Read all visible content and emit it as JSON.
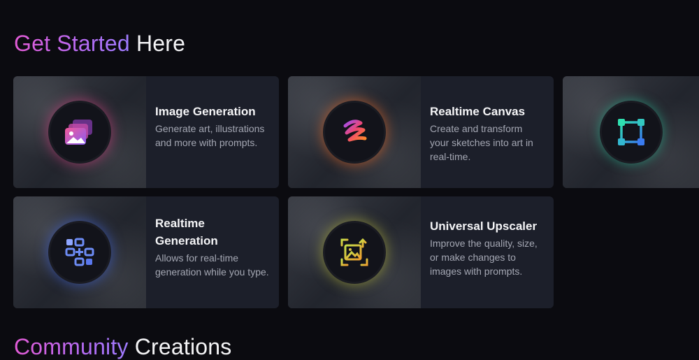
{
  "get_started": {
    "title_highlight": "Get Started",
    "title_rest": "Here"
  },
  "cards": [
    {
      "title": "Image Generation",
      "description": "Generate art, illustrations and more with prompts.",
      "icon": "images-icon"
    },
    {
      "title": "Realtime Canvas",
      "description": "Create and transform your sketches into art in real-time.",
      "icon": "brush-stroke-icon"
    },
    {
      "title": "",
      "description": "",
      "icon": "vector-square-icon"
    },
    {
      "title": "Realtime Generation",
      "description": "Allows for real-time generation while you type.",
      "icon": "grid-plus-icon"
    },
    {
      "title": "Universal Upscaler",
      "description": "Improve the quality, size, or make changes to images with prompts.",
      "icon": "image-upscale-icon"
    }
  ],
  "community": {
    "title_highlight": "Community",
    "title_rest": "Creations"
  },
  "colors": {
    "accent_gradient_start": "#e25bd6",
    "accent_gradient_end": "#9f7cff",
    "card_bg": "#1c1f2a",
    "page_bg": "#0b0b10"
  }
}
